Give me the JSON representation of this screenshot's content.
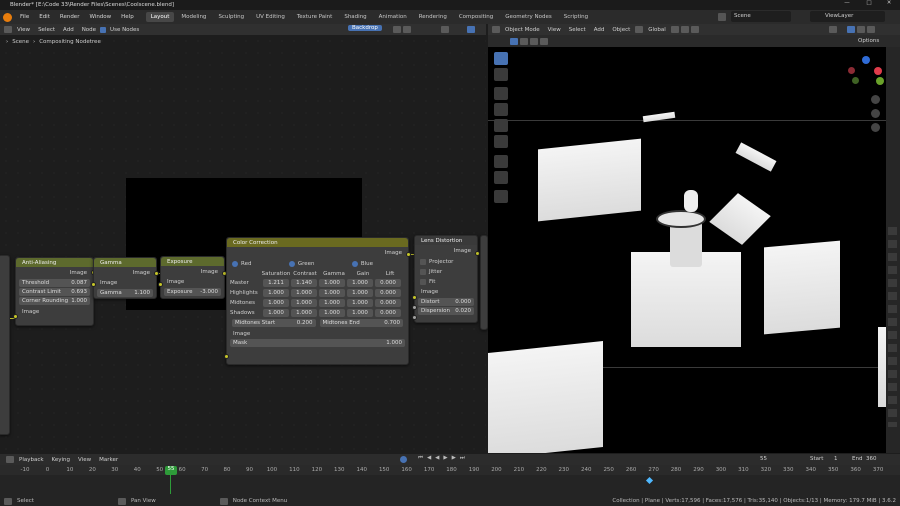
{
  "window": {
    "title": "Blender* [E:\\Code 33\\Render Files\\Scenes\\Coolscene.blend]"
  },
  "topbar": {
    "menus": [
      "File",
      "Edit",
      "Render",
      "Window",
      "Help"
    ],
    "workspaces": [
      "Layout",
      "Modeling",
      "Sculpting",
      "UV Editing",
      "Texture Paint",
      "Shading",
      "Animation",
      "Rendering",
      "Compositing",
      "Geometry Nodes",
      "Scripting"
    ],
    "active_workspace": "Layout",
    "scene": "Scene",
    "view_layer": "ViewLayer"
  },
  "compositor": {
    "menus": [
      "View",
      "Select",
      "Add",
      "Node"
    ],
    "use_nodes_label": "Use Nodes",
    "backdrop_label": "Backdrop",
    "breadcrumb_scene": "Scene",
    "breadcrumb_tree": "Compositing Nodetree"
  },
  "nodes": {
    "antialias": {
      "title": "Anti-Aliasing",
      "out": "Image",
      "threshold_label": "Threshold",
      "threshold": "0.087",
      "contrast_label": "Contrast Limit",
      "contrast": "0.693",
      "corner_label": "Corner Rounding",
      "corner": "1.000",
      "in": "Image"
    },
    "gamma": {
      "title": "Gamma",
      "out": "Image",
      "in": "Image",
      "gamma_label": "Gamma",
      "gamma": "1.100"
    },
    "exposure": {
      "title": "Exposure",
      "out": "Image",
      "in": "Image",
      "exposure_label": "Exposure",
      "exposure": "-3.000"
    },
    "colorcorr": {
      "title": "Color Correction",
      "out": "Image",
      "red": "Red",
      "green": "Green",
      "blue": "Blue",
      "cols": [
        "Saturation",
        "Contrast",
        "Gamma",
        "Gain",
        "Lift"
      ],
      "rows": [
        {
          "label": "Master",
          "vals": [
            "1.211",
            "1.140",
            "1.000",
            "1.000",
            "0.000"
          ]
        },
        {
          "label": "Highlights",
          "vals": [
            "1.000",
            "1.000",
            "1.000",
            "1.000",
            "0.000"
          ]
        },
        {
          "label": "Midtones",
          "vals": [
            "1.000",
            "1.000",
            "1.000",
            "1.000",
            "0.000"
          ]
        },
        {
          "label": "Shadows",
          "vals": [
            "1.000",
            "1.000",
            "1.000",
            "1.000",
            "0.000"
          ]
        }
      ],
      "mid_start_label": "Midtones Start",
      "mid_start": "0.200",
      "mid_end_label": "Midtones End",
      "mid_end": "0.700",
      "in_image": "Image",
      "mask_label": "Mask",
      "mask": "1.000"
    },
    "lens": {
      "title": "Lens Distortion",
      "out": "Image",
      "projector": "Projector",
      "jitter": "Jitter",
      "fit": "Fit",
      "in": "Image",
      "distort_label": "Distort",
      "distort": "0.000",
      "dispersion_label": "Dispersion",
      "dispersion": "0.020"
    }
  },
  "viewport": {
    "mode": "Object Mode",
    "menus": [
      "View",
      "Select",
      "Add",
      "Object"
    ],
    "orientation": "Global",
    "options": "Options"
  },
  "timeline": {
    "menus": [
      "Playback",
      "Keying",
      "View",
      "Marker"
    ],
    "current_frame": "55",
    "start_label": "Start",
    "start": "1",
    "end_label": "End",
    "end": "360",
    "ticks": [
      "-10",
      "0",
      "10",
      "20",
      "30",
      "40",
      "50",
      "60",
      "70",
      "80",
      "90",
      "100",
      "110",
      "120",
      "130",
      "140",
      "150",
      "160",
      "170",
      "180",
      "190",
      "200",
      "210",
      "220",
      "230",
      "240",
      "250",
      "260",
      "270",
      "280",
      "290",
      "300",
      "310",
      "320",
      "330",
      "340",
      "350",
      "360",
      "370"
    ],
    "current_marker": "55"
  },
  "status": {
    "select": "Select",
    "pan": "Pan View",
    "context": "Node Context Menu",
    "stats": "Collection | Plane | Verts:17,596 | Faces:17,576 | Tris:35,140 | Objects:1/13 | Memory: 179.7 MiB | 3.6.2"
  },
  "colors": {
    "accent": "#4772b3",
    "socket": "#c7c729",
    "blender_orange": "#e87d0d"
  }
}
